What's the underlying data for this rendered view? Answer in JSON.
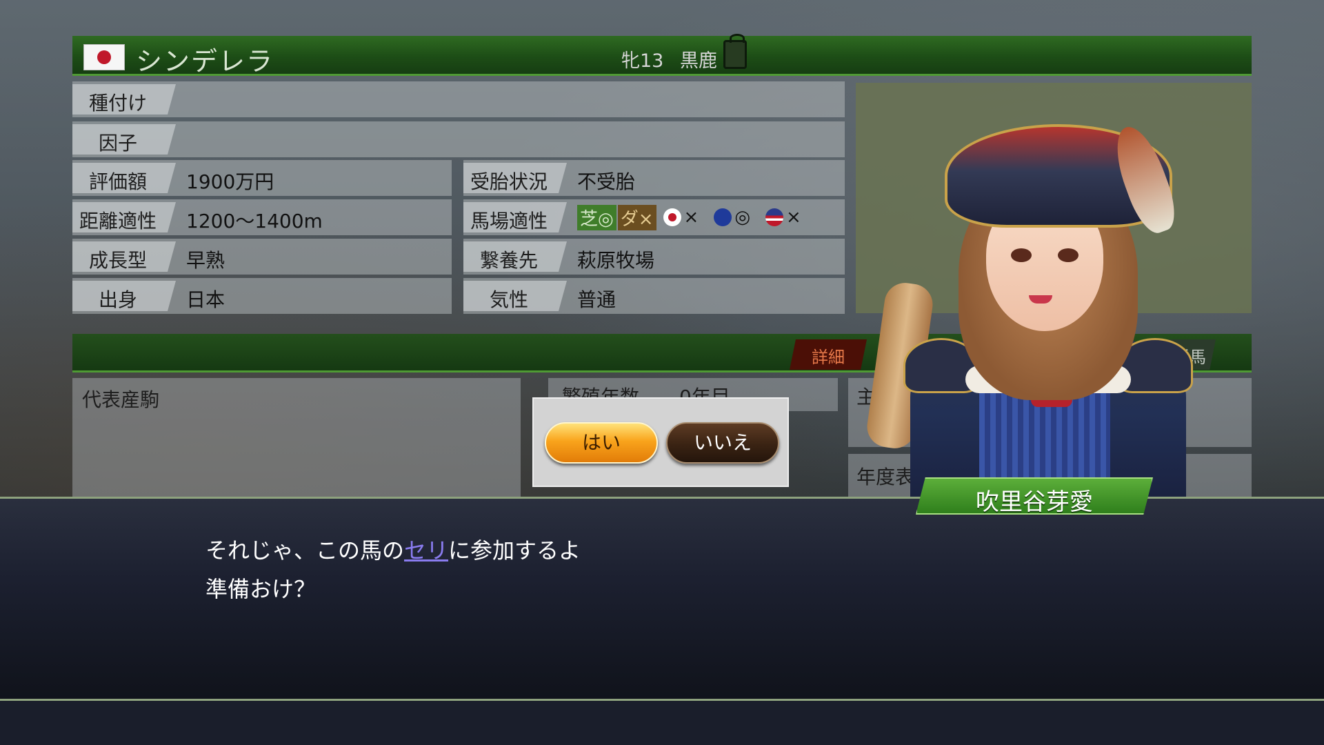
{
  "horse": {
    "name": "シンデレラ",
    "sex_age": "牝13",
    "coat": "黒鹿",
    "flag_icon": "japan-flag-icon"
  },
  "info_rows": [
    {
      "label": "種付け",
      "value": ""
    },
    {
      "label": "因子",
      "value": ""
    }
  ],
  "left_stats": [
    {
      "label": "評価額",
      "value": "1900万円"
    },
    {
      "label": "距離適性",
      "value": "1200〜1400m"
    },
    {
      "label": "成長型",
      "value": "早熟"
    },
    {
      "label": "出身",
      "value": "日本"
    }
  ],
  "right_stats": [
    {
      "label": "受胎状況",
      "value": "不受胎"
    },
    {
      "label": "馬場適性",
      "value": ""
    },
    {
      "label": "繋養先",
      "value": "萩原牧場"
    },
    {
      "label": "気性",
      "value": "普通"
    }
  ],
  "track_aptitude": {
    "turf_label": "芝",
    "turf_mark": "◎",
    "dirt_label": "ダ",
    "dirt_mark": "×",
    "jp_mark": "×",
    "eu_mark": "◎",
    "us_mark": "×"
  },
  "tabs": {
    "detail": "詳細",
    "related": "係馬"
  },
  "lower": {
    "representative_offspring": "代表産駒",
    "breeding_years": "繁殖年数",
    "years_value": "0年目",
    "main_wins": "主な勝鞍",
    "annual_awards": "年度表彰"
  },
  "dialog": {
    "yes": "はい",
    "no": "いいえ"
  },
  "character": {
    "name": "吹里谷芽愛"
  },
  "message": {
    "line1_pre": "それじゃ、この馬の",
    "line1_link": "セリ",
    "line1_post": "に参加するよ",
    "line2": "準備おけ？"
  },
  "colors": {
    "title_green": "#1d4d16",
    "accent_green": "#4f9a34",
    "yes_orange": "#f9a41c",
    "no_brown": "#3a2313",
    "link_purple": "#8a7cf0"
  }
}
